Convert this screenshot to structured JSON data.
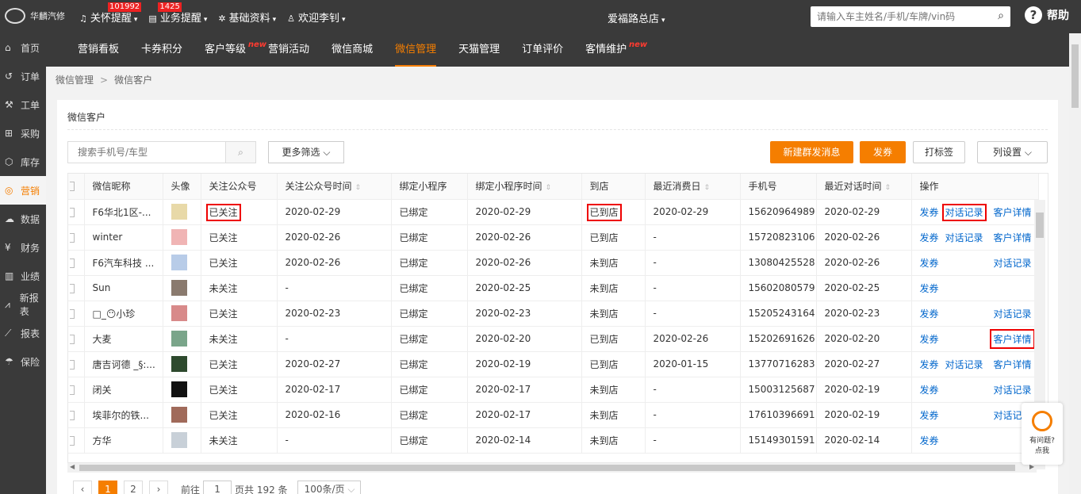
{
  "brand": {
    "logo_text": "华麟汽修"
  },
  "topnav": [
    {
      "icon": "bell-icon",
      "label": "关怀提醒",
      "badge": "101992"
    },
    {
      "icon": "list-icon",
      "label": "业务提醒",
      "badge": "1425"
    },
    {
      "icon": "gear-icon",
      "label": "基础资料",
      "badge": ""
    },
    {
      "icon": "user-icon",
      "label": "欢迎李钊",
      "badge": ""
    }
  ],
  "store": "爱福路总店",
  "search": {
    "placeholder": "请输入车主姓名/手机/车牌/vin码"
  },
  "help_label": "帮助",
  "sidebar": [
    {
      "label": "首页",
      "icon": "home-icon"
    },
    {
      "label": "订单",
      "icon": "history-icon"
    },
    {
      "label": "工单",
      "icon": "wrench-icon"
    },
    {
      "label": "采购",
      "icon": "cart-icon"
    },
    {
      "label": "库存",
      "icon": "box-icon"
    },
    {
      "label": "营销",
      "icon": "target-icon",
      "active": true
    },
    {
      "label": "数据",
      "icon": "cloud-icon"
    },
    {
      "label": "财务",
      "icon": "yen-icon"
    },
    {
      "label": "业绩",
      "icon": "bar-chart-icon"
    },
    {
      "label": "新报表",
      "icon": "line-chart-icon"
    },
    {
      "label": "报表",
      "icon": "trend-icon"
    },
    {
      "label": "保险",
      "icon": "umbrella-icon"
    }
  ],
  "subnav": [
    {
      "label": "营销看板",
      "new": ""
    },
    {
      "label": "卡券积分",
      "new": ""
    },
    {
      "label": "客户等级",
      "new": "new"
    },
    {
      "label": "营销活动",
      "new": ""
    },
    {
      "label": "微信商城",
      "new": ""
    },
    {
      "label": "微信管理",
      "new": "",
      "active": true
    },
    {
      "label": "天猫管理",
      "new": ""
    },
    {
      "label": "订单评价",
      "new": ""
    },
    {
      "label": "客情维护",
      "new": "new"
    }
  ],
  "breadcrumb": {
    "parent": "微信管理",
    "current": "微信客户"
  },
  "card_title": "微信客户",
  "filters": {
    "search_placeholder": "搜索手机号/车型",
    "more_label": "更多筛选"
  },
  "actions": {
    "new_broadcast": "新建群发消息",
    "send_coupon": "发券",
    "tag": "打标签",
    "columns": "列设置"
  },
  "table": {
    "columns": [
      "微信昵称",
      "头像",
      "关注公众号",
      "关注公众号时间",
      "绑定小程序",
      "绑定小程序时间",
      "到店",
      "最近消费日",
      "手机号",
      "最近对话时间",
      "操作"
    ],
    "sortable": [
      false,
      false,
      false,
      true,
      false,
      true,
      false,
      true,
      false,
      true,
      false
    ],
    "rows": [
      {
        "name": "F6华北1区-...",
        "avatar": "#e8d9a8",
        "follow": "已关注",
        "follow_time": "2020-02-29",
        "bind": "已绑定",
        "bind_time": "2020-02-29",
        "visit": "已到店",
        "last_spend": "2020-02-29",
        "phone": "15620964989",
        "last_chat": "2020-02-29",
        "ops": [
          "发券",
          "对话记录",
          "客户详情"
        ]
      },
      {
        "name": "winter",
        "avatar": "#f0b4b4",
        "follow": "已关注",
        "follow_time": "2020-02-26",
        "bind": "已绑定",
        "bind_time": "2020-02-26",
        "visit": "已到店",
        "last_spend": "-",
        "phone": "15720823106",
        "last_chat": "2020-02-26",
        "ops": [
          "发券",
          "对话记录",
          "客户详情"
        ]
      },
      {
        "name": "F6汽车科技 ...",
        "avatar": "#b8cce8",
        "follow": "已关注",
        "follow_time": "2020-02-26",
        "bind": "已绑定",
        "bind_time": "2020-02-26",
        "visit": "未到店",
        "last_spend": "-",
        "phone": "13080425528",
        "last_chat": "2020-02-26",
        "ops": [
          "发券",
          "",
          "对话记录"
        ]
      },
      {
        "name": "Sun",
        "avatar": "#8a7a6e",
        "follow": "未关注",
        "follow_time": "-",
        "bind": "已绑定",
        "bind_time": "2020-02-25",
        "visit": "未到店",
        "last_spend": "-",
        "phone": "15602080579",
        "last_chat": "2020-02-25",
        "ops": [
          "发券",
          "",
          ""
        ]
      },
      {
        "name": "□_😶小珍",
        "avatar": "#d88a8a",
        "follow": "已关注",
        "follow_time": "2020-02-23",
        "bind": "已绑定",
        "bind_time": "2020-02-23",
        "visit": "未到店",
        "last_spend": "-",
        "phone": "15205243164",
        "last_chat": "2020-02-23",
        "ops": [
          "发券",
          "",
          "对话记录"
        ]
      },
      {
        "name": "大麦",
        "avatar": "#7aa58a",
        "follow": "未关注",
        "follow_time": "-",
        "bind": "已绑定",
        "bind_time": "2020-02-20",
        "visit": "已到店",
        "last_spend": "2020-02-26",
        "phone": "15202691626",
        "last_chat": "2020-02-20",
        "ops": [
          "发券",
          "",
          "客户详情"
        ]
      },
      {
        "name": "唐吉诃德 _§:...",
        "avatar": "#2e4a2e",
        "follow": "已关注",
        "follow_time": "2020-02-27",
        "bind": "已绑定",
        "bind_time": "2020-02-19",
        "visit": "已到店",
        "last_spend": "2020-01-15",
        "phone": "13770716283",
        "last_chat": "2020-02-27",
        "ops": [
          "发券",
          "对话记录",
          "客户详情"
        ]
      },
      {
        "name": "闭关",
        "avatar": "#111111",
        "follow": "已关注",
        "follow_time": "2020-02-17",
        "bind": "已绑定",
        "bind_time": "2020-02-17",
        "visit": "未到店",
        "last_spend": "-",
        "phone": "15003125687",
        "last_chat": "2020-02-19",
        "ops": [
          "发券",
          "",
          "对话记录"
        ]
      },
      {
        "name": "埃菲尔的铁...",
        "avatar": "#a06a5a",
        "follow": "已关注",
        "follow_time": "2020-02-16",
        "bind": "已绑定",
        "bind_time": "2020-02-17",
        "visit": "未到店",
        "last_spend": "-",
        "phone": "17610396691",
        "last_chat": "2020-02-19",
        "ops": [
          "发券",
          "",
          "对话记录"
        ]
      },
      {
        "name": "方华",
        "avatar": "#c8d0d8",
        "follow": "未关注",
        "follow_time": "-",
        "bind": "已绑定",
        "bind_time": "2020-02-14",
        "visit": "未到店",
        "last_spend": "-",
        "phone": "15149301591",
        "last_chat": "2020-02-14",
        "ops": [
          "发券",
          "",
          ""
        ]
      }
    ]
  },
  "pagination": {
    "pages": [
      "1",
      "2"
    ],
    "current": "1",
    "goto_label": "前往",
    "goto_value": "1",
    "total_text": "页共 192 条",
    "page_size": "100条/页"
  },
  "float_help": {
    "line1": "有问题?",
    "line2": "点我"
  }
}
